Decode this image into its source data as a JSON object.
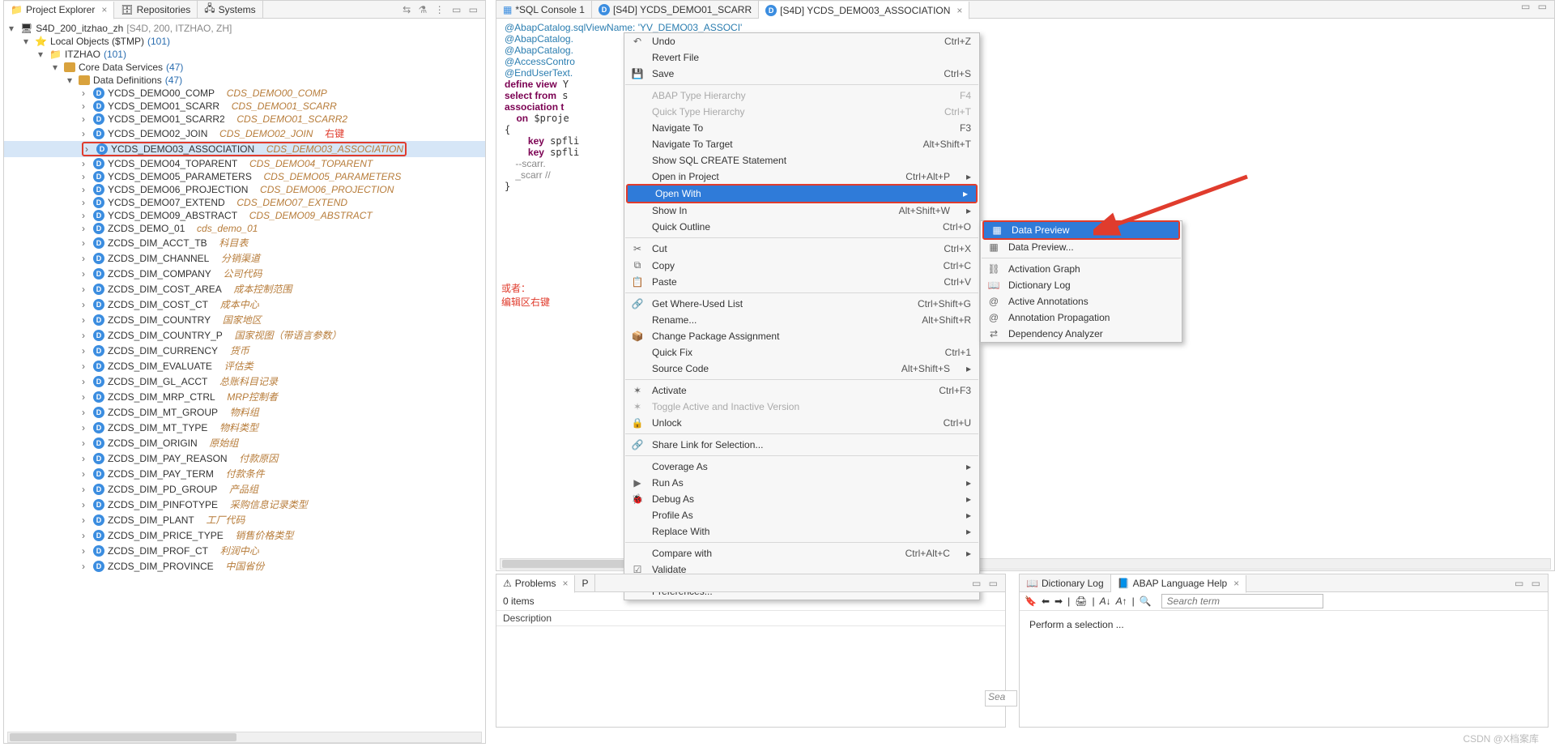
{
  "explorer": {
    "tabs": [
      "Project Explorer",
      "Repositories",
      "Systems"
    ],
    "toolbar_glyphs": "⇆ ⚗ ⋮ ▭ ▭",
    "root": {
      "label": "S4D_200_itzhao_zh",
      "suffix": "[S4D, 200, ITZHAO, ZH]"
    },
    "local_objects": {
      "label": "Local Objects ($TMP)",
      "count": "(101)"
    },
    "itzhao": {
      "label": "ITZHAO",
      "count": "(101)"
    },
    "cds": {
      "label": "Core Data Services",
      "count": "(47)"
    },
    "dd": {
      "label": "Data Definitions",
      "count": "(47)"
    },
    "right_click_note": "右键",
    "items": [
      {
        "name": "YCDS_DEMO00_COMP",
        "desc": "CDS_DEMO00_COMP"
      },
      {
        "name": "YCDS_DEMO01_SCARR",
        "desc": "CDS_DEMO01_SCARR"
      },
      {
        "name": "YCDS_DEMO01_SCARR2",
        "desc": "CDS_DEMO01_SCARR2"
      },
      {
        "name": "YCDS_DEMO02_JOIN",
        "desc": "CDS_DEMO02_JOIN"
      },
      {
        "name": "YCDS_DEMO03_ASSOCIATION",
        "desc": "CDS_DEMO03_ASSOCIATION",
        "selected": true
      },
      {
        "name": "YCDS_DEMO04_TOPARENT",
        "desc": "CDS_DEMO04_TOPARENT"
      },
      {
        "name": "YCDS_DEMO05_PARAMETERS",
        "desc": "CDS_DEMO05_PARAMETERS"
      },
      {
        "name": "YCDS_DEMO06_PROJECTION",
        "desc": "CDS_DEMO06_PROJECTION"
      },
      {
        "name": "YCDS_DEMO07_EXTEND",
        "desc": "CDS_DEMO07_EXTEND"
      },
      {
        "name": "YCDS_DEMO09_ABSTRACT",
        "desc": "CDS_DEMO09_ABSTRACT"
      },
      {
        "name": "ZCDS_DEMO_01",
        "desc": "cds_demo_01"
      },
      {
        "name": "ZCDS_DIM_ACCT_TB",
        "desc": "科目表"
      },
      {
        "name": "ZCDS_DIM_CHANNEL",
        "desc": "分销渠道"
      },
      {
        "name": "ZCDS_DIM_COMPANY",
        "desc": "公司代码"
      },
      {
        "name": "ZCDS_DIM_COST_AREA",
        "desc": "成本控制范围"
      },
      {
        "name": "ZCDS_DIM_COST_CT",
        "desc": "成本中心"
      },
      {
        "name": "ZCDS_DIM_COUNTRY",
        "desc": "国家地区"
      },
      {
        "name": "ZCDS_DIM_COUNTRY_P",
        "desc": "国家视图（带语言参数）"
      },
      {
        "name": "ZCDS_DIM_CURRENCY",
        "desc": "货币"
      },
      {
        "name": "ZCDS_DIM_EVALUATE",
        "desc": "评估类"
      },
      {
        "name": "ZCDS_DIM_GL_ACCT",
        "desc": "总账科目记录"
      },
      {
        "name": "ZCDS_DIM_MRP_CTRL",
        "desc": "MRP控制者"
      },
      {
        "name": "ZCDS_DIM_MT_GROUP",
        "desc": "物料组"
      },
      {
        "name": "ZCDS_DIM_MT_TYPE",
        "desc": "物料类型"
      },
      {
        "name": "ZCDS_DIM_ORIGIN",
        "desc": "原始组"
      },
      {
        "name": "ZCDS_DIM_PAY_REASON",
        "desc": "付款原因"
      },
      {
        "name": "ZCDS_DIM_PAY_TERM",
        "desc": "付款条件"
      },
      {
        "name": "ZCDS_DIM_PD_GROUP",
        "desc": "产品组"
      },
      {
        "name": "ZCDS_DIM_PINFOTYPE",
        "desc": "采购信息记录类型"
      },
      {
        "name": "ZCDS_DIM_PLANT",
        "desc": "工厂代码"
      },
      {
        "name": "ZCDS_DIM_PRICE_TYPE",
        "desc": "销售价格类型"
      },
      {
        "name": "ZCDS_DIM_PROF_CT",
        "desc": "利润中心"
      },
      {
        "name": "ZCDS_DIM_PROVINCE",
        "desc": "中国省份"
      }
    ]
  },
  "editor": {
    "tabs": [
      {
        "label": "*SQL Console 1",
        "icon": "sql",
        "dirty": true
      },
      {
        "label": "[S4D] YCDS_DEMO01_SCARR",
        "icon": "d"
      },
      {
        "label": "[S4D] YCDS_DEMO03_ASSOCIATION",
        "icon": "d",
        "active": true
      }
    ],
    "code_lines": [
      "@AbapCatalog.sqlViewName: 'YV_DEMO03_ASSOCI'",
      "@AbapCatalog.",
      "@AbapCatalog.",
      "@AccessContro",
      "@EndUserText.",
      "define view Y",
      "select from s",
      "association t",
      "  on $proje",
      "{",
      "    key spfli",
      "    key spfli",
      "    --scarr.",
      "    _scarr //",
      "}"
    ],
    "cn_note1": "或者：",
    "cn_note2": "编辑区右键"
  },
  "context_menu": {
    "items": [
      {
        "ic": "↶",
        "txt": "Undo",
        "sc": "Ctrl+Z"
      },
      {
        "ic": "",
        "txt": "Revert File"
      },
      {
        "ic": "💾",
        "txt": "Save",
        "sc": "Ctrl+S"
      },
      {
        "sep": true
      },
      {
        "ic": "",
        "txt": "ABAP Type Hierarchy",
        "sc": "F4",
        "disabled": true
      },
      {
        "ic": "",
        "txt": "Quick Type Hierarchy",
        "sc": "Ctrl+T",
        "disabled": true
      },
      {
        "ic": "",
        "txt": "Navigate To",
        "sc": "F3"
      },
      {
        "ic": "",
        "txt": "Navigate To Target",
        "sc": "Alt+Shift+T"
      },
      {
        "ic": "",
        "txt": "Show SQL CREATE Statement"
      },
      {
        "ic": "",
        "txt": "Open in Project",
        "sc": "Ctrl+Alt+P",
        "arrow": true
      },
      {
        "ic": "",
        "txt": "Open With",
        "arrow": true,
        "hl": true,
        "boxed": true
      },
      {
        "ic": "",
        "txt": "Show In",
        "sc": "Alt+Shift+W",
        "arrow": true
      },
      {
        "ic": "",
        "txt": "Quick Outline",
        "sc": "Ctrl+O"
      },
      {
        "sep": true
      },
      {
        "ic": "✂",
        "txt": "Cut",
        "sc": "Ctrl+X"
      },
      {
        "ic": "⧉",
        "txt": "Copy",
        "sc": "Ctrl+C"
      },
      {
        "ic": "📋",
        "txt": "Paste",
        "sc": "Ctrl+V"
      },
      {
        "sep": true
      },
      {
        "ic": "🔗",
        "txt": "Get Where-Used List",
        "sc": "Ctrl+Shift+G"
      },
      {
        "ic": "",
        "txt": "Rename...",
        "sc": "Alt+Shift+R"
      },
      {
        "ic": "📦",
        "txt": "Change Package Assignment"
      },
      {
        "ic": "",
        "txt": "Quick Fix",
        "sc": "Ctrl+1"
      },
      {
        "ic": "",
        "txt": "Source Code",
        "sc": "Alt+Shift+S",
        "arrow": true
      },
      {
        "sep": true
      },
      {
        "ic": "✶",
        "txt": "Activate",
        "sc": "Ctrl+F3"
      },
      {
        "ic": "✶",
        "txt": "Toggle Active and Inactive Version",
        "disabled": true
      },
      {
        "ic": "🔒",
        "txt": "Unlock",
        "sc": "Ctrl+U"
      },
      {
        "sep": true
      },
      {
        "ic": "🔗",
        "txt": "Share Link for Selection..."
      },
      {
        "sep": true
      },
      {
        "ic": "",
        "txt": "Coverage As",
        "arrow": true
      },
      {
        "ic": "▶",
        "txt": "Run As",
        "arrow": true
      },
      {
        "ic": "🐞",
        "txt": "Debug As",
        "arrow": true
      },
      {
        "ic": "",
        "txt": "Profile As",
        "arrow": true
      },
      {
        "ic": "",
        "txt": "Replace With",
        "arrow": true
      },
      {
        "sep": true
      },
      {
        "ic": "",
        "txt": "Compare with",
        "sc": "Ctrl+Alt+C",
        "arrow": true
      },
      {
        "ic": "☑",
        "txt": "Validate"
      },
      {
        "sep": true
      },
      {
        "ic": "",
        "txt": "Preferences..."
      }
    ]
  },
  "submenu": {
    "items": [
      {
        "ic": "▦",
        "txt": "Data Preview",
        "hl": true,
        "boxed": true
      },
      {
        "ic": "▦",
        "txt": "Data Preview..."
      },
      {
        "sep": true
      },
      {
        "ic": "⛓",
        "txt": "Activation Graph"
      },
      {
        "ic": "📖",
        "txt": "Dictionary Log"
      },
      {
        "ic": "@",
        "txt": "Active Annotations"
      },
      {
        "ic": "@",
        "txt": "Annotation Propagation"
      },
      {
        "ic": "⇄",
        "txt": "Dependency Analyzer"
      }
    ]
  },
  "problems": {
    "tabs": [
      "Problems",
      "P"
    ],
    "items_count": "0 items",
    "col": "Description",
    "search_placeholder": "Sea"
  },
  "help": {
    "tabs": [
      "Dictionary Log",
      "ABAP Language Help"
    ],
    "search_placeholder": "Search term",
    "body": "Perform a selection ..."
  },
  "watermark": "CSDN @X档案库"
}
